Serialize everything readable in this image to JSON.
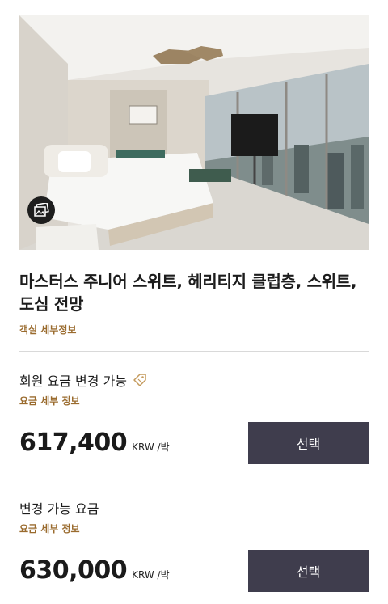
{
  "room": {
    "title": "마스터스 주니어 스위트, 헤리티지 클럽층, 스위트, 도심 전망",
    "details_link": "객실 세부정보",
    "image_alt": "room photo"
  },
  "rates": [
    {
      "name": "회원 요금 변경 가능",
      "has_tag_icon": true,
      "details_link": "요금 세부 정보",
      "price": "617,400",
      "unit": "KRW /박",
      "button": "선택"
    },
    {
      "name": "변경 가능 요금",
      "has_tag_icon": false,
      "details_link": "요금 세부 정보",
      "price": "630,000",
      "unit": "KRW /박",
      "button": "선택"
    }
  ],
  "colors": {
    "accent": "#9a6b2e",
    "button": "#3f3d4d"
  },
  "icons": {
    "gallery": "gallery-icon",
    "tag": "tag-icon"
  }
}
